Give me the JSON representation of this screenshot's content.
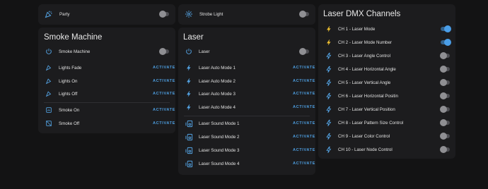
{
  "top_cards": {
    "party": {
      "label": "Party",
      "on": false
    },
    "strobe": {
      "label": "Strobe Light",
      "on": false
    }
  },
  "smoke_card": {
    "title": "Smoke Machine",
    "toggle_row": {
      "label": "Smoke Machine",
      "on": false
    },
    "scenes_a": [
      {
        "label": "Lights Fade",
        "action": "ACTIVATE"
      },
      {
        "label": "Lights On",
        "action": "ACTIVATE"
      },
      {
        "label": "Lights Off",
        "action": "ACTIVATE"
      }
    ],
    "scenes_b": [
      {
        "label": "Smoke On",
        "action": "ACTIVATE"
      },
      {
        "label": "Smoke Off",
        "action": "ACTIVATE"
      }
    ]
  },
  "laser_card": {
    "title": "Laser",
    "toggle_row": {
      "label": "Laser",
      "on": false
    },
    "auto_modes": [
      {
        "label": "Laser Auto Mode 1",
        "action": "ACTIVATE"
      },
      {
        "label": "Laser Auto Mode 2",
        "action": "ACTIVATE"
      },
      {
        "label": "Laser Auto Mode 3",
        "action": "ACTIVATE"
      },
      {
        "label": "Laser Auto Mode 4",
        "action": "ACTIVATE"
      }
    ],
    "sound_modes": [
      {
        "label": "Laser Sound Mode 1",
        "action": "ACTIVATE"
      },
      {
        "label": "Laser Sound Mode 2",
        "action": "ACTIVATE"
      },
      {
        "label": "Laser Sound Mode 3",
        "action": "ACTIVATE"
      },
      {
        "label": "Laser Sound Mode 4",
        "action": "ACTIVATE"
      }
    ]
  },
  "dmx_card": {
    "title": "Laser DMX Channels",
    "channels": [
      {
        "label": "CH 1 - Laser Mode",
        "on": true,
        "icon": "flash-icon"
      },
      {
        "label": "CH 2 - Laser Mode Number",
        "on": true,
        "icon": "flash-icon"
      },
      {
        "label": "CH 3 - Laser Angle Control",
        "on": false,
        "icon": "flash-outline-icon"
      },
      {
        "label": "CH 4 - Laser Horizontal Angle",
        "on": false,
        "icon": "flash-outline-icon"
      },
      {
        "label": "CH 5 - Laser Vertical Angle",
        "on": false,
        "icon": "flash-outline-icon"
      },
      {
        "label": "CH 6 - Laser Horizontal Positin",
        "on": false,
        "icon": "flash-outline-icon"
      },
      {
        "label": "CH 7 - Laser Vertical Position",
        "on": false,
        "icon": "flash-outline-icon"
      },
      {
        "label": "CH 8 - Laser Pattern Size Control",
        "on": false,
        "icon": "flash-outline-icon"
      },
      {
        "label": "CH 9 - Laser Color Control",
        "on": false,
        "icon": "flash-outline-icon"
      },
      {
        "label": "CH 10 - Laser Node Control",
        "on": false,
        "icon": "flash-outline-icon"
      }
    ]
  },
  "colors": {
    "accent": "#4d9ddf",
    "flash_on": "#f2c230",
    "card": "#1c1c1e",
    "background": "#131314"
  }
}
